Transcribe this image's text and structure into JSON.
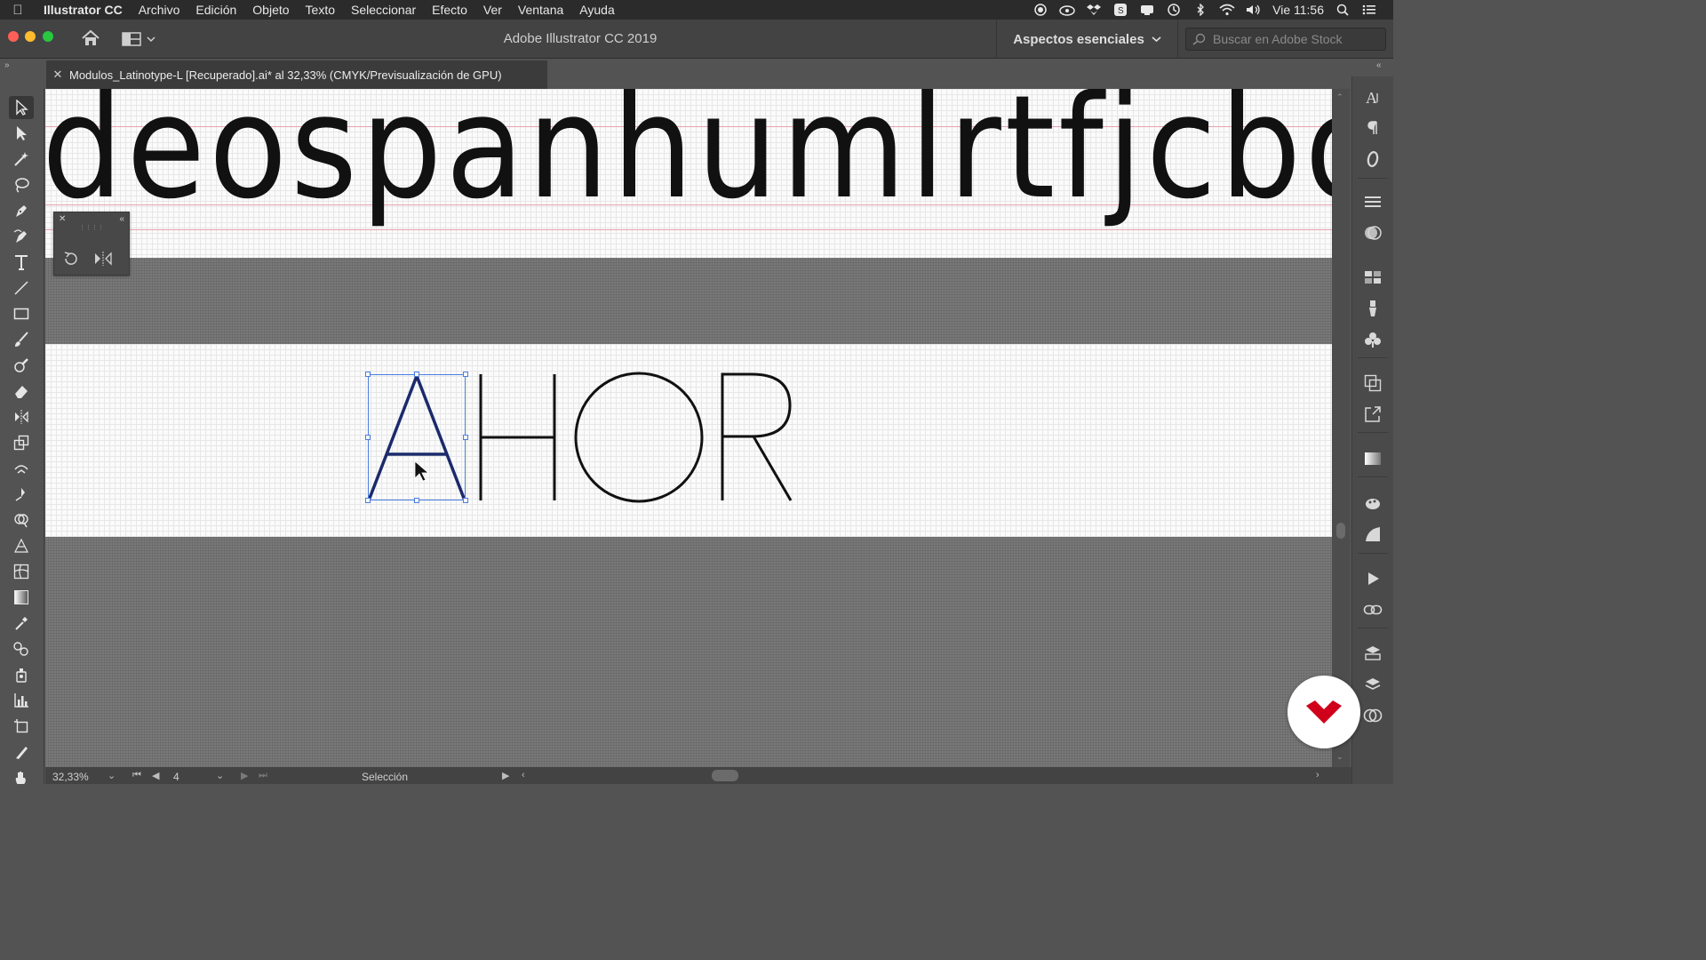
{
  "menubar": {
    "app_name": "Illustrator CC",
    "items": [
      "Archivo",
      "Edición",
      "Objeto",
      "Texto",
      "Seleccionar",
      "Efecto",
      "Ver",
      "Ventana",
      "Ayuda"
    ],
    "clock": "Vie 11:56"
  },
  "appbar": {
    "title": "Adobe Illustrator CC 2019",
    "workspace": "Aspectos esenciales",
    "search_placeholder": "Buscar en Adobe Stock"
  },
  "document": {
    "tab_title": "Modulos_Latinotype-L [Recuperado].ai* al 32,33% (CMYK/Previsualización de GPU)",
    "lowercase_glyphs": "deospanhumlrtfjcbo",
    "uppercase_glyphs": "AHOR"
  },
  "statusbar": {
    "zoom": "32,33%",
    "artboard": "4",
    "tool_state": "Selección"
  },
  "colors": {
    "ui_dark": "#434343",
    "ui_mid": "#535353",
    "selection": "#4a7de0",
    "guide": "#e8a3ad",
    "brand": "#d0021b"
  }
}
